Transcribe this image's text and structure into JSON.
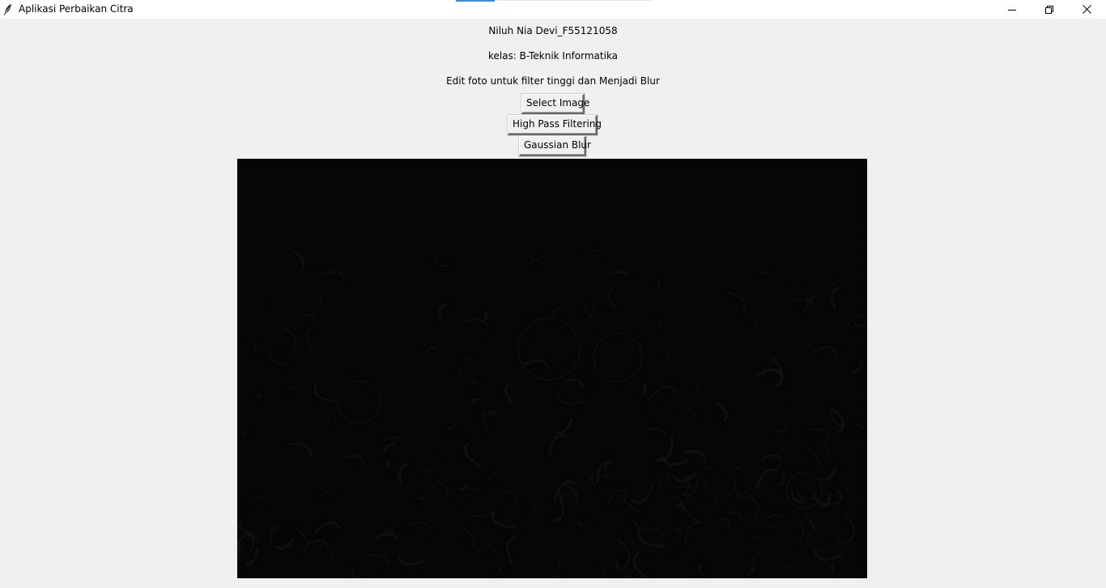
{
  "window": {
    "title": "Aplikasi Perbaikan Citra",
    "icon": "feather-icon",
    "controls": {
      "minimize_icon": "minimize-icon",
      "maximize_icon": "restore-icon",
      "close_icon": "close-icon"
    }
  },
  "labels": {
    "name": "Niluh Nia Devi_F55121058",
    "class": "kelas: B-Teknik Informatika",
    "description": "Edit foto untuk filter tinggi dan Menjadi Blur"
  },
  "buttons": {
    "select_image": "Select Image",
    "high_pass": "High Pass Filtering",
    "gaussian_blur": "Gaussian Blur"
  },
  "image": {
    "filter_applied": "High Pass Filtering",
    "background_color": "#050505",
    "edge_color": "#2a2a2a"
  },
  "colors": {
    "window_bg": "#f0f0f0",
    "titlebar_bg": "#ffffff",
    "accent": "#3c8fd6"
  }
}
